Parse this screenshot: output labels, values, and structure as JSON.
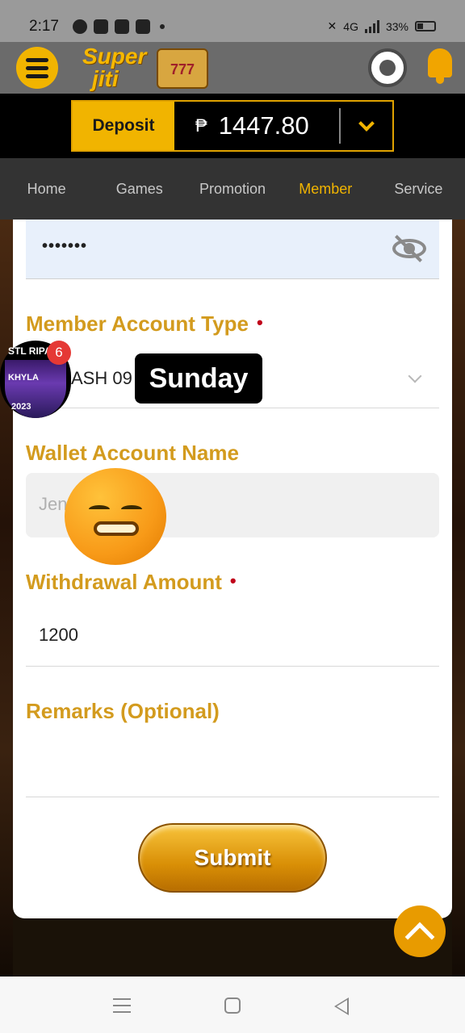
{
  "status_bar": {
    "time": "2:17",
    "network": "4G",
    "battery": "33%"
  },
  "header": {
    "logo_line1": "Super",
    "logo_line2": "jiti",
    "logo_reels": "777"
  },
  "balance": {
    "deposit_label": "Deposit",
    "currency": "₱",
    "amount": "1447.80"
  },
  "nav": [
    {
      "label": "Home",
      "active": false
    },
    {
      "label": "Games",
      "active": false
    },
    {
      "label": "Promotion",
      "active": false
    },
    {
      "label": "Member",
      "active": true
    },
    {
      "label": "Service",
      "active": false
    }
  ],
  "form": {
    "password_value": "•••••••",
    "account_type_label": "Member Account Type",
    "account_type_value": "ASH 09",
    "wallet_name_label": "Wallet Account Name",
    "wallet_name_value": "Jen",
    "amount_label": "Withdrawal Amount",
    "amount_value": "1200",
    "remarks_label": "Remarks (Optional)",
    "required_mark": "•",
    "submit_label": "Submit"
  },
  "overlays": {
    "bubble_line1": "STL RIPA",
    "bubble_line2": "KHYLA",
    "bubble_line3": "2023",
    "bubble_badge": "6",
    "day_label": "Sunday"
  },
  "colors": {
    "accent": "#f1b400",
    "label": "#d39b1e",
    "required": "#c0001a"
  }
}
